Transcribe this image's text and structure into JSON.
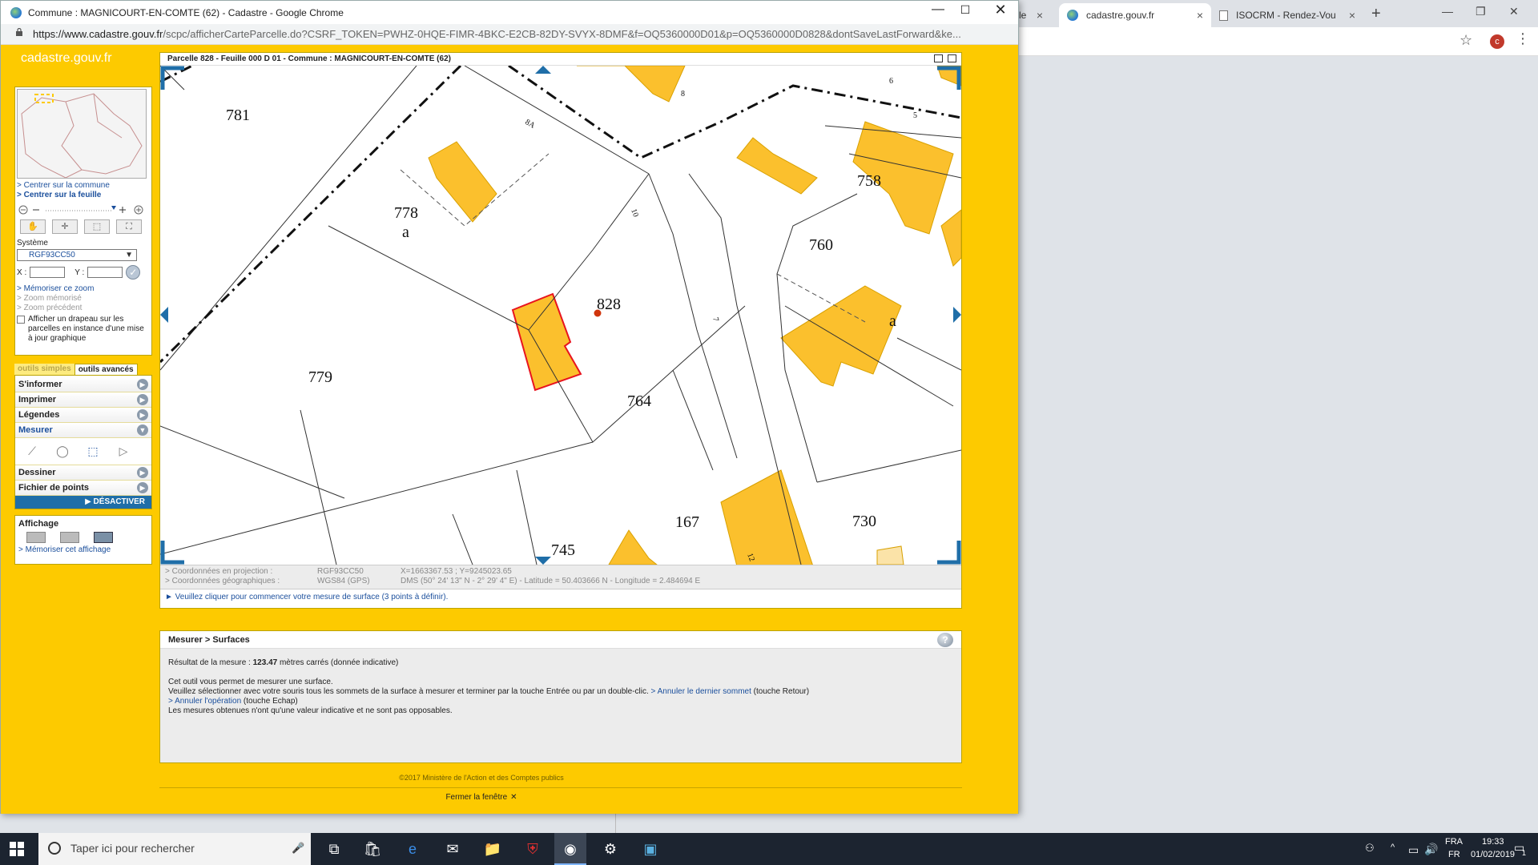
{
  "window": {
    "title": "Commune : MAGNICOURT-EN-COMTE (62) - Cadastre - Google Chrome",
    "url_host": "https://www.cadastre.gouv.fr",
    "url_path": "/scpc/afficherCarteParcelle.do?CSRF_TOKEN=PWHZ-0HQE-FIMR-4BKC-E2CB-82DY-SVYX-8DMF&f=OQ5360000D01&p=OQ5360000D0828&dontSaveLastForward&ke..."
  },
  "background_browser": {
    "tab_partial": "le",
    "tabs": [
      {
        "label": "cadastre.gouv.fr",
        "icon": "globe-icon"
      },
      {
        "label": "ISOCRM - Rendez-Vou",
        "icon": "document-icon"
      }
    ]
  },
  "site": {
    "logo": "cadastre.gouv.fr",
    "left_panel": {
      "links_top": [
        "> Centrer sur la commune",
        "> Centrer sur la feuille"
      ],
      "systeme_label": "Système",
      "systeme_value": "RGF93CC50",
      "x_label": "X :",
      "y_label": "Y :",
      "zoom_links": [
        {
          "label": "> Mémoriser ce zoom",
          "enabled": true
        },
        {
          "label": "> Zoom mémorisé",
          "enabled": false
        },
        {
          "label": "> Zoom précédent",
          "enabled": false
        }
      ],
      "flag_checkbox_label": "Afficher un drapeau sur les parcelles en instance d'une mise à jour graphique",
      "tabs": {
        "simple": "outils simples",
        "advanced": "outils avancés"
      },
      "menu": [
        {
          "label": "S'informer",
          "active": false
        },
        {
          "label": "Imprimer",
          "active": false
        },
        {
          "label": "Légendes",
          "active": false
        },
        {
          "label": "Mesurer",
          "active": true
        }
      ],
      "menu_after": [
        {
          "label": "Dessiner"
        },
        {
          "label": "Fichier de points"
        }
      ],
      "deactivate_label": "▶ DÉSACTIVER",
      "affichage_title": "Affichage",
      "affichage_link": "> Mémoriser cet affichage"
    },
    "map": {
      "header": "Parcelle 828 - Feuille 000 D 01 - Commune : MAGNICOURT-EN-COMTE (62)",
      "parcel_labels": [
        "781",
        "778",
        "a",
        "828",
        "779",
        "764",
        "745",
        "167",
        "730",
        "760",
        "758",
        "a"
      ],
      "street_numbers": [
        "8",
        "6",
        "5",
        "8A",
        "10",
        "7",
        "12"
      ],
      "coords": {
        "projection_label": "> Coordonnées en projection :",
        "projection_system": "RGF93CC50",
        "projection_value": "X=1663367.53 ; Y=9245023.65",
        "geographic_label": "> Coordonnées géographiques :",
        "geographic_system": "WGS84 (GPS)",
        "geographic_value": "DMS (50° 24' 13\" N - 2° 29' 4\" E) - Latitude = 50.403666 N - Longitude = 2.484694 E"
      },
      "instruction": "► Veuillez cliquer pour commencer votre mesure de surface (3 points à définir)."
    },
    "results": {
      "title": "Mesurer > Surfaces",
      "result_prefix": "Résultat de la mesure : ",
      "result_value": "123.47",
      "result_suffix": " mètres carrés (donnée indicative)",
      "line1": "Cet outil vous permet de mesurer une surface.",
      "line2_a": "Veuillez sélectionner avec votre souris tous les sommets de la surface à mesurer et terminer par la touche Entrée ou par un double-clic. ",
      "line2_link": "> Annuler le dernier sommet",
      "line2_b": " (touche Retour)",
      "line3_link": "> Annuler l'opération",
      "line3_b": " (touche Echap)",
      "line4": "Les mesures obtenues n'ont qu'une valeur indicative et ne sont pas opposables."
    },
    "footer_copy": "©2017 Ministère de l'Action et des Comptes publics",
    "close_window": "Fermer la fenêtre"
  },
  "taskbar": {
    "search_placeholder": "Taper ici pour rechercher",
    "lang_top": "FRA",
    "lang_bottom": "FR",
    "time": "19:33",
    "date": "01/02/2019",
    "notif_count": "1"
  },
  "colors": {
    "site_yellow": "#fdca00",
    "parcel_building": "#fbc02d",
    "selected_outline": "#e8141e",
    "link_blue": "#1b4f9c"
  }
}
